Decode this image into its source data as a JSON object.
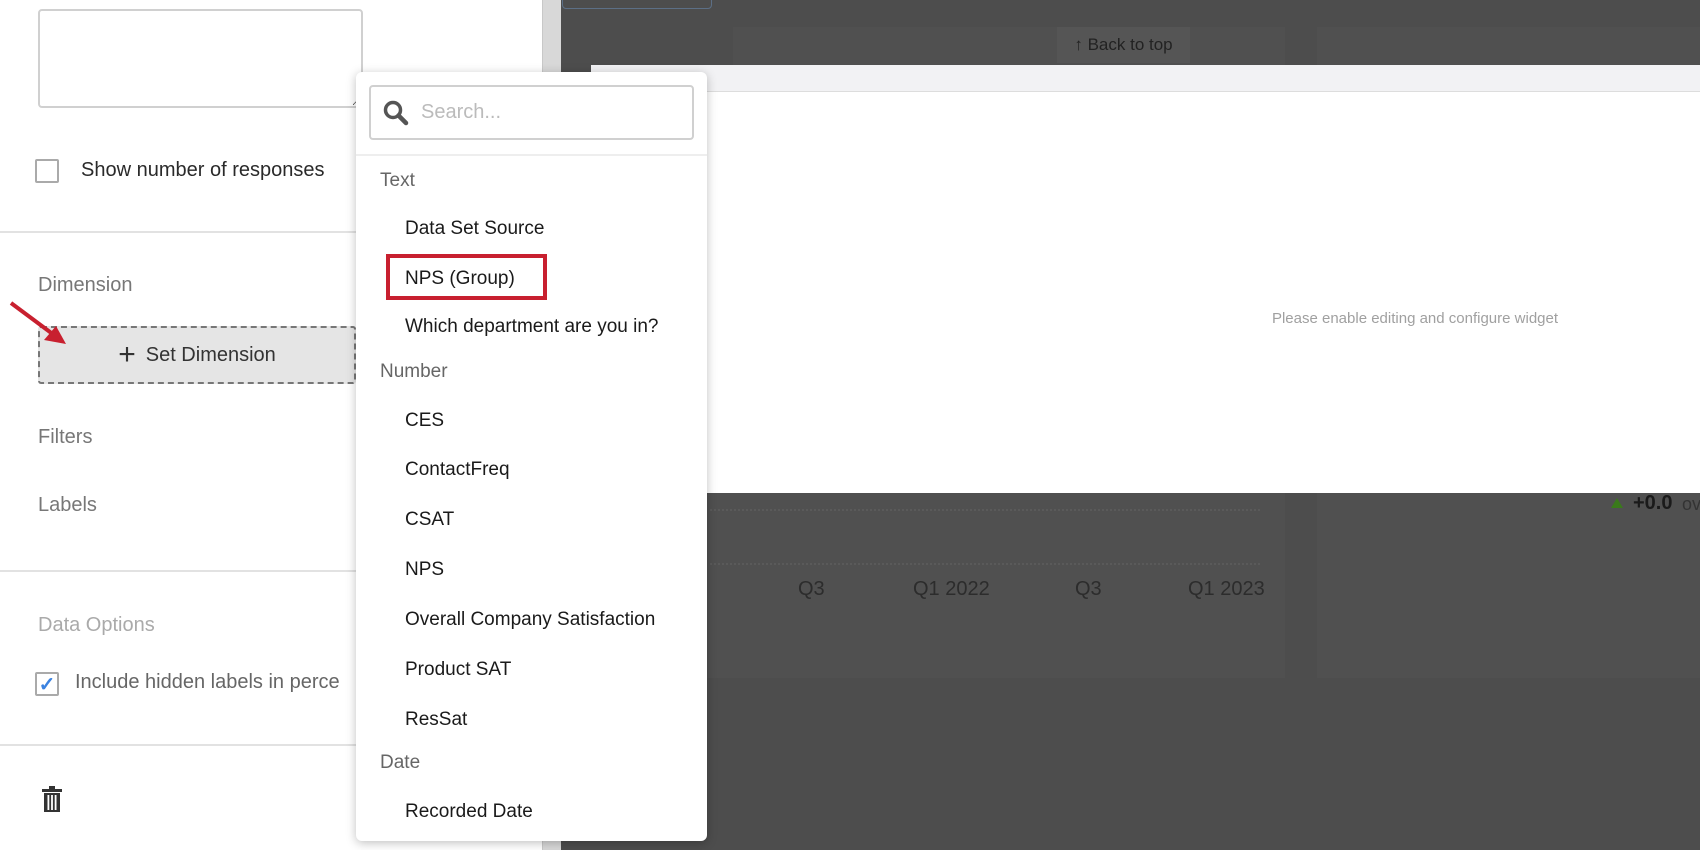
{
  "left_panel": {
    "show_responses_label": "Show number of responses",
    "dimension_label": "Dimension",
    "set_dimension_label": "Set Dimension",
    "filters_label": "Filters",
    "labels_label": "Labels",
    "data_options_label": "Data Options",
    "include_hidden_label": "Include hidden labels in perce"
  },
  "dropdown": {
    "search_placeholder": "Search...",
    "groups": [
      {
        "label": "Text",
        "items": [
          "Data Set Source",
          "NPS (Group)",
          "Which department are you in?"
        ]
      },
      {
        "label": "Number",
        "items": [
          "CES",
          "ContactFreq",
          "CSAT",
          "NPS",
          "Overall Company Satisfaction",
          "Product SAT",
          "ResSat"
        ]
      },
      {
        "label": "Date",
        "items": [
          "Recorded Date"
        ]
      }
    ]
  },
  "background": {
    "back_to_top": "↑ Back to top",
    "widget_placeholder": "Please enable editing and configure widget",
    "axis_labels": [
      "Q3",
      "Q1 2022",
      "Q3",
      "Q1 2023"
    ],
    "delta_value": "+0.0",
    "delta_suffix": "ov"
  },
  "colors": {
    "highlight": "#c8202f",
    "check": "#3b82e0"
  }
}
